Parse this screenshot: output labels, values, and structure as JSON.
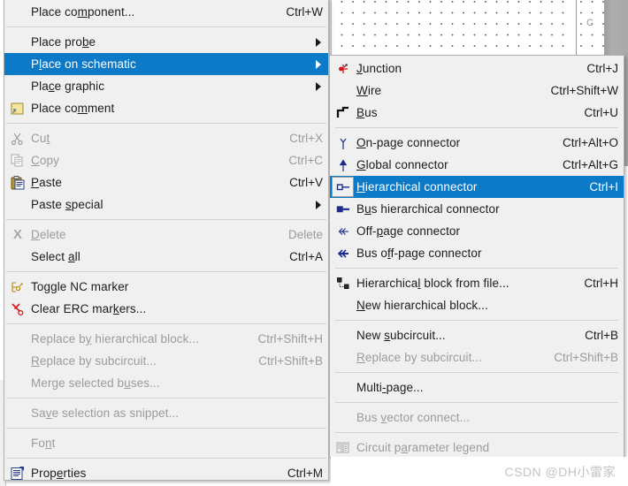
{
  "canvas": {
    "sheet_label": "C"
  },
  "watermark": "CSDN @DH小雷家",
  "main_menu": {
    "items": [
      {
        "label": "Place component...",
        "accel": "Ctrl+W",
        "icon": "none",
        "disabled": false,
        "submenu": false,
        "selected": false
      },
      {
        "type": "separator"
      },
      {
        "label": "Place probe",
        "accel": "",
        "icon": "none",
        "disabled": false,
        "submenu": true,
        "selected": false
      },
      {
        "label": "Place on schematic",
        "accel": "",
        "icon": "none",
        "disabled": false,
        "submenu": true,
        "selected": true
      },
      {
        "label": "Place graphic",
        "accel": "",
        "icon": "none",
        "disabled": false,
        "submenu": true,
        "selected": false
      },
      {
        "label": "Place comment",
        "accel": "",
        "icon": "comment-icon",
        "disabled": false,
        "submenu": false,
        "selected": false
      },
      {
        "type": "separator"
      },
      {
        "label": "Cut",
        "accel": "Ctrl+X",
        "icon": "scissors-icon",
        "disabled": true,
        "submenu": false,
        "selected": false
      },
      {
        "label": "Copy",
        "accel": "Ctrl+C",
        "icon": "copy-icon",
        "disabled": true,
        "submenu": false,
        "selected": false
      },
      {
        "label": "Paste",
        "accel": "Ctrl+V",
        "icon": "paste-icon",
        "disabled": false,
        "submenu": false,
        "selected": false
      },
      {
        "label": "Paste special",
        "accel": "",
        "icon": "none",
        "disabled": false,
        "submenu": true,
        "selected": false
      },
      {
        "type": "separator"
      },
      {
        "label": "Delete",
        "accel": "Delete",
        "icon": "delete-x-icon",
        "disabled": true,
        "submenu": false,
        "selected": false
      },
      {
        "label": "Select all",
        "accel": "Ctrl+A",
        "icon": "none",
        "disabled": false,
        "submenu": false,
        "selected": false
      },
      {
        "type": "separator"
      },
      {
        "label": "Toggle NC marker",
        "accel": "",
        "icon": "nc-marker-icon",
        "disabled": false,
        "submenu": false,
        "selected": false
      },
      {
        "label": "Clear ERC markers...",
        "accel": "",
        "icon": "clear-erc-icon",
        "disabled": false,
        "submenu": false,
        "selected": false
      },
      {
        "type": "separator"
      },
      {
        "label": "Replace by hierarchical block...",
        "accel": "Ctrl+Shift+H",
        "icon": "none",
        "disabled": true,
        "submenu": false,
        "selected": false
      },
      {
        "label": "Replace by subcircuit...",
        "accel": "Ctrl+Shift+B",
        "icon": "none",
        "disabled": true,
        "submenu": false,
        "selected": false
      },
      {
        "label": "Merge selected buses...",
        "accel": "",
        "icon": "none",
        "disabled": true,
        "submenu": false,
        "selected": false
      },
      {
        "type": "separator"
      },
      {
        "label": "Save selection as snippet...",
        "accel": "",
        "icon": "none",
        "disabled": true,
        "submenu": false,
        "selected": false
      },
      {
        "type": "separator"
      },
      {
        "label": "Font",
        "accel": "",
        "icon": "none",
        "disabled": true,
        "submenu": false,
        "selected": false
      },
      {
        "type": "separator"
      },
      {
        "label": "Properties",
        "accel": "Ctrl+M",
        "icon": "properties-icon",
        "disabled": false,
        "submenu": false,
        "selected": false
      }
    ]
  },
  "sub_menu": {
    "items": [
      {
        "label": "Junction",
        "accel": "Ctrl+J",
        "icon": "junction-icon",
        "disabled": false,
        "selected": false
      },
      {
        "label": "Wire",
        "accel": "Ctrl+Shift+W",
        "icon": "none",
        "disabled": false,
        "selected": false
      },
      {
        "label": "Bus",
        "accel": "Ctrl+U",
        "icon": "bus-icon",
        "disabled": false,
        "selected": false
      },
      {
        "type": "separator"
      },
      {
        "label": "On-page connector",
        "accel": "Ctrl+Alt+O",
        "icon": "onpage-connector-icon",
        "disabled": false,
        "selected": false
      },
      {
        "label": "Global connector",
        "accel": "Ctrl+Alt+G",
        "icon": "global-connector-icon",
        "disabled": false,
        "selected": false
      },
      {
        "label": "Hierarchical connector",
        "accel": "Ctrl+I",
        "icon": "hierarchical-connector-icon",
        "disabled": false,
        "selected": true
      },
      {
        "label": "Bus hierarchical connector",
        "accel": "",
        "icon": "bus-hierarchical-connector-icon",
        "disabled": false,
        "selected": false
      },
      {
        "label": "Off-page connector",
        "accel": "",
        "icon": "offpage-connector-icon",
        "disabled": false,
        "selected": false
      },
      {
        "label": "Bus off-page connector",
        "accel": "",
        "icon": "bus-offpage-connector-icon",
        "disabled": false,
        "selected": false
      },
      {
        "type": "separator"
      },
      {
        "label": "Hierarchical block from file...",
        "accel": "Ctrl+H",
        "icon": "hierarchical-block-icon",
        "disabled": false,
        "selected": false
      },
      {
        "label": "New hierarchical block...",
        "accel": "",
        "icon": "none",
        "disabled": false,
        "selected": false
      },
      {
        "type": "separator"
      },
      {
        "label": "New subcircuit...",
        "accel": "Ctrl+B",
        "icon": "none",
        "disabled": false,
        "selected": false
      },
      {
        "label": "Replace by subcircuit...",
        "accel": "Ctrl+Shift+B",
        "icon": "none",
        "disabled": true,
        "selected": false
      },
      {
        "type": "separator"
      },
      {
        "label": "Multi-page...",
        "accel": "",
        "icon": "none",
        "disabled": false,
        "selected": false
      },
      {
        "type": "separator"
      },
      {
        "label": "Bus vector connect...",
        "accel": "",
        "icon": "none",
        "disabled": true,
        "selected": false
      },
      {
        "type": "separator"
      },
      {
        "label": "Circuit parameter legend",
        "accel": "",
        "icon": "circuit-legend-icon",
        "disabled": true,
        "selected": false
      }
    ]
  },
  "colors": {
    "menu_background": "#f0f0f0",
    "highlight": "#0d7ac8",
    "text": "#1b1b1b",
    "disabled_text": "#9b9b9b",
    "separator": "#d2d2d2",
    "accent_navy": "#1b2d8f",
    "accent_red": "#d41616",
    "watermark": "#c3c3c3"
  }
}
